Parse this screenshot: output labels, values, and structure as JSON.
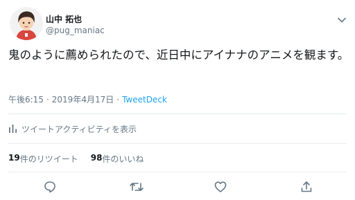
{
  "user": {
    "display_name": "山中 拓也",
    "handle": "@pug_maniac"
  },
  "tweet": {
    "text": "鬼のように薦められたので、近日中にアイナナのアニメを観ます。",
    "time": "午後6:15",
    "separator": "·",
    "date": "2019年4月17日",
    "source": "TweetDeck"
  },
  "activity": {
    "label": "ツイートアクティビティを表示"
  },
  "stats": {
    "retweets_count": "19",
    "retweets_label": "件のリツイート",
    "likes_count": "98",
    "likes_label": "件のいいね"
  },
  "colors": {
    "link": "#1da1f2",
    "secondary_text": "#657786",
    "primary_text": "#14171a",
    "divider": "#e6ecf0"
  },
  "icons": [
    "chevron-down-icon",
    "bar-chart-icon",
    "reply-icon",
    "retweet-icon",
    "heart-icon",
    "share-icon"
  ]
}
